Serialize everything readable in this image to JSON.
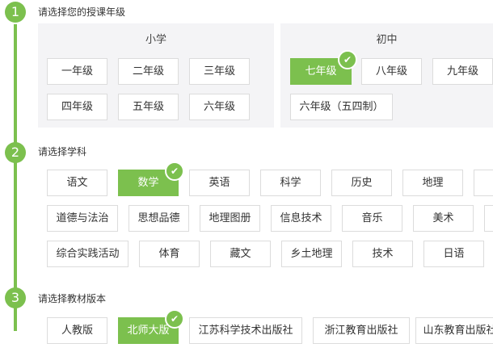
{
  "steps": [
    {
      "number": "1",
      "title": "请选择您的授课年级"
    },
    {
      "number": "2",
      "title": "请选择学科"
    },
    {
      "number": "3",
      "title": "请选择教材版本"
    }
  ],
  "grade": {
    "primary": {
      "title": "小学",
      "options": [
        "一年级",
        "二年级",
        "三年级",
        "四年级",
        "五年级",
        "六年级"
      ]
    },
    "junior": {
      "title": "初中",
      "options": [
        "七年级",
        "八年级",
        "九年级",
        "六年级（五四制）"
      ],
      "selected": "七年级"
    }
  },
  "subjects": {
    "options": [
      "语文",
      "数学",
      "英语",
      "科学",
      "历史",
      "地理",
      "道德与法治",
      "思想品德",
      "地理图册",
      "信息技术",
      "音乐",
      "美术",
      "综合实践活动",
      "体育",
      "藏文",
      "乡土地理",
      "技术",
      "日语"
    ],
    "selected": "数学"
  },
  "editions": {
    "options": [
      "人教版",
      "北师大版",
      "江苏科学技术出版社",
      "浙江教育出版社",
      "山东教育出版社"
    ],
    "selected": "北师大版"
  },
  "check_icon": "✔",
  "colors": {
    "accent": "#7cc04e",
    "panel_bg": "#f4f4f6",
    "border": "#dcdcdc"
  }
}
